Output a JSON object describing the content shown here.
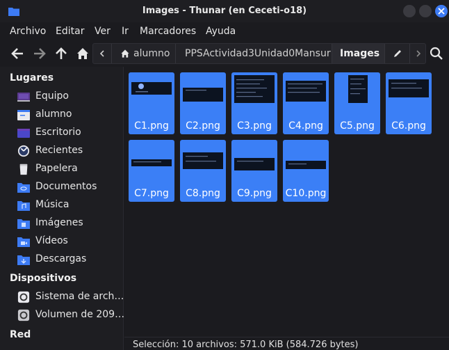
{
  "window": {
    "title": "Images - Thunar (en Ceceti-o18)",
    "accent": "#3d7bf4"
  },
  "menu": [
    "Archivo",
    "Editar",
    "Ver",
    "Ir",
    "Marcadores",
    "Ayuda"
  ],
  "path": {
    "home_icon": "home-icon",
    "crumbs": [
      "alumno",
      "PPSActividad3Unidad0Mansur",
      "Images"
    ],
    "active": "Images"
  },
  "sidebar": {
    "places_heading": "Lugares",
    "places": [
      {
        "label": "Equipo",
        "icon": "computer-icon"
      },
      {
        "label": "alumno",
        "icon": "home-folder-icon"
      },
      {
        "label": "Escritorio",
        "icon": "desktop-icon"
      },
      {
        "label": "Recientes",
        "icon": "recent-icon"
      },
      {
        "label": "Papelera",
        "icon": "trash-icon"
      },
      {
        "label": "Documentos",
        "icon": "documents-folder-icon"
      },
      {
        "label": "Música",
        "icon": "music-folder-icon"
      },
      {
        "label": "Imágenes",
        "icon": "pictures-folder-icon"
      },
      {
        "label": "Vídeos",
        "icon": "videos-folder-icon"
      },
      {
        "label": "Descargas",
        "icon": "downloads-folder-icon"
      }
    ],
    "devices_heading": "Dispositivos",
    "devices": [
      {
        "label": "Sistema de arch…",
        "icon": "drive-icon"
      },
      {
        "label": "Volumen de 209…",
        "icon": "volume-icon"
      }
    ],
    "network_heading": "Red"
  },
  "files": [
    {
      "name": "C1.png"
    },
    {
      "name": "C2.png"
    },
    {
      "name": "C3.png"
    },
    {
      "name": "C4.png"
    },
    {
      "name": "C5.png"
    },
    {
      "name": "C6.png"
    },
    {
      "name": "C7.png"
    },
    {
      "name": "C8.png"
    },
    {
      "name": "C9.png"
    },
    {
      "name": "C10.png"
    }
  ],
  "status": "Selección: 10 archivos: 571.0 KiB (584.726 bytes)",
  "colors": {
    "selection": "#3b7ff6",
    "background": "#1b1b1f",
    "sidebar": "#1e1e22"
  }
}
